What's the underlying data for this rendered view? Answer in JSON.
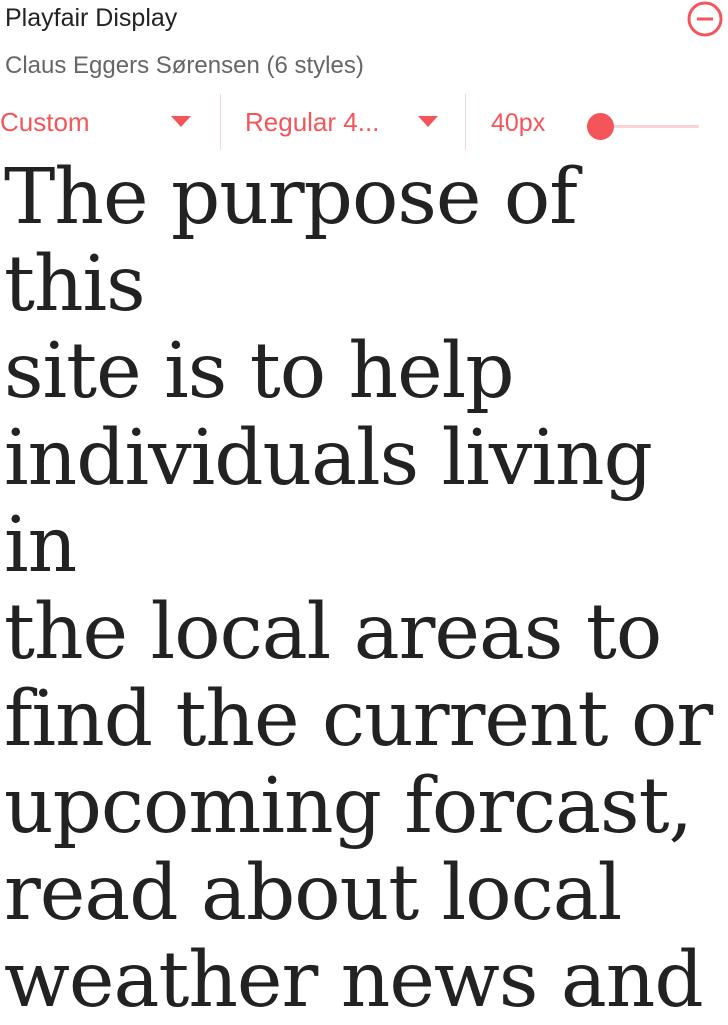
{
  "font_card": {
    "family_name": "Playfair Display",
    "designer": "Claus Eggers Sørensen (6 styles)",
    "remove_icon": "remove-circle-icon"
  },
  "controls": {
    "preset_select": {
      "value": "Custom"
    },
    "style_select": {
      "value": "Regular 4..."
    },
    "size_label": "40px",
    "size_slider_level": 0.0
  },
  "preview": {
    "text": "The purpose of this\nsite is to help\nindividuals living in\nthe local areas to\nfind the current or\nupcoming forcast,\nread about local\nweather news and"
  },
  "colors": {
    "accent": "#f4555a",
    "accent_light": "#fbd2d3",
    "text_primary": "#222222",
    "text_secondary": "#666666"
  }
}
